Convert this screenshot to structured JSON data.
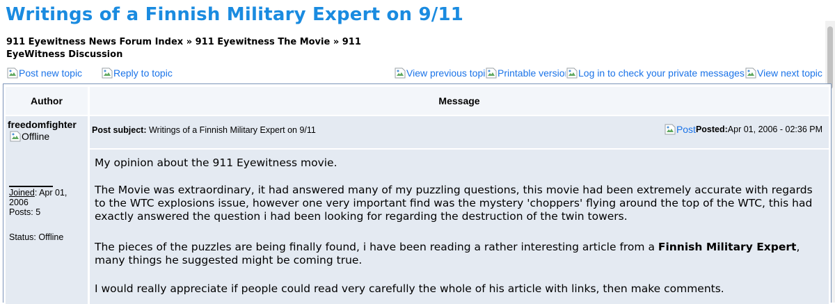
{
  "page": {
    "title": "Writings of a Finnish Military Expert on 9/11"
  },
  "breadcrumb": {
    "index": "911 Eyewitness News Forum Index",
    "sep1": " » ",
    "category": "911 Eyewitness The Movie",
    "sep2": " » ",
    "forum": "911 EyeWitness Discussion"
  },
  "actions": {
    "post_new_topic": "Post new topic",
    "reply_to_topic": "Reply to topic",
    "view_previous": "View previous topic",
    "printable": "Printable version",
    "log_in": "Log in to check your private messages",
    "view_next": "View next topic"
  },
  "table": {
    "header_author": "Author",
    "header_message": "Message"
  },
  "post": {
    "username": "freedomfighter",
    "offline_img_alt": "Offline",
    "joined_label": "Joined",
    "joined_value": ": Apr 01, 2006",
    "posts": "Posts: 5",
    "status": "Status: Offline",
    "subject_label": "Post subject:",
    "subject_value": " Writings of a Finnish Military Expert on 9/11",
    "post_img_alt": "Post",
    "posted_label": "Posted:",
    "posted_value": " Apr 01, 2006 - 02:36 PM",
    "p1": "My opinion about the 911 Eyewitness movie.",
    "p2": "The Movie was extraordinary, it had answered many of my puzzling questions, this movie had been extremely accurate with regards to the WTC explosions issue, however one very important find was the mystery 'choppers' flying around the top of the WTC, this had exactly answered the question i had been looking for regarding the destruction of the twin towers.",
    "p3_before": "The pieces of the puzzles are being finally found, i have been reading a rather interesting article from a ",
    "p3_bold": "Finnish Military Expert",
    "p3_after": ", many things he suggested might be coming true.",
    "p4": "I would really appreciate if people could read very carefully the whole of his article with links, then make comments."
  },
  "icons": {
    "broken_image": "broken-image-icon"
  },
  "colors": {
    "title": "#1a8be0",
    "link": "#1a73e8",
    "row_bg": "#e4eaf2",
    "border": "#7a93b8"
  }
}
